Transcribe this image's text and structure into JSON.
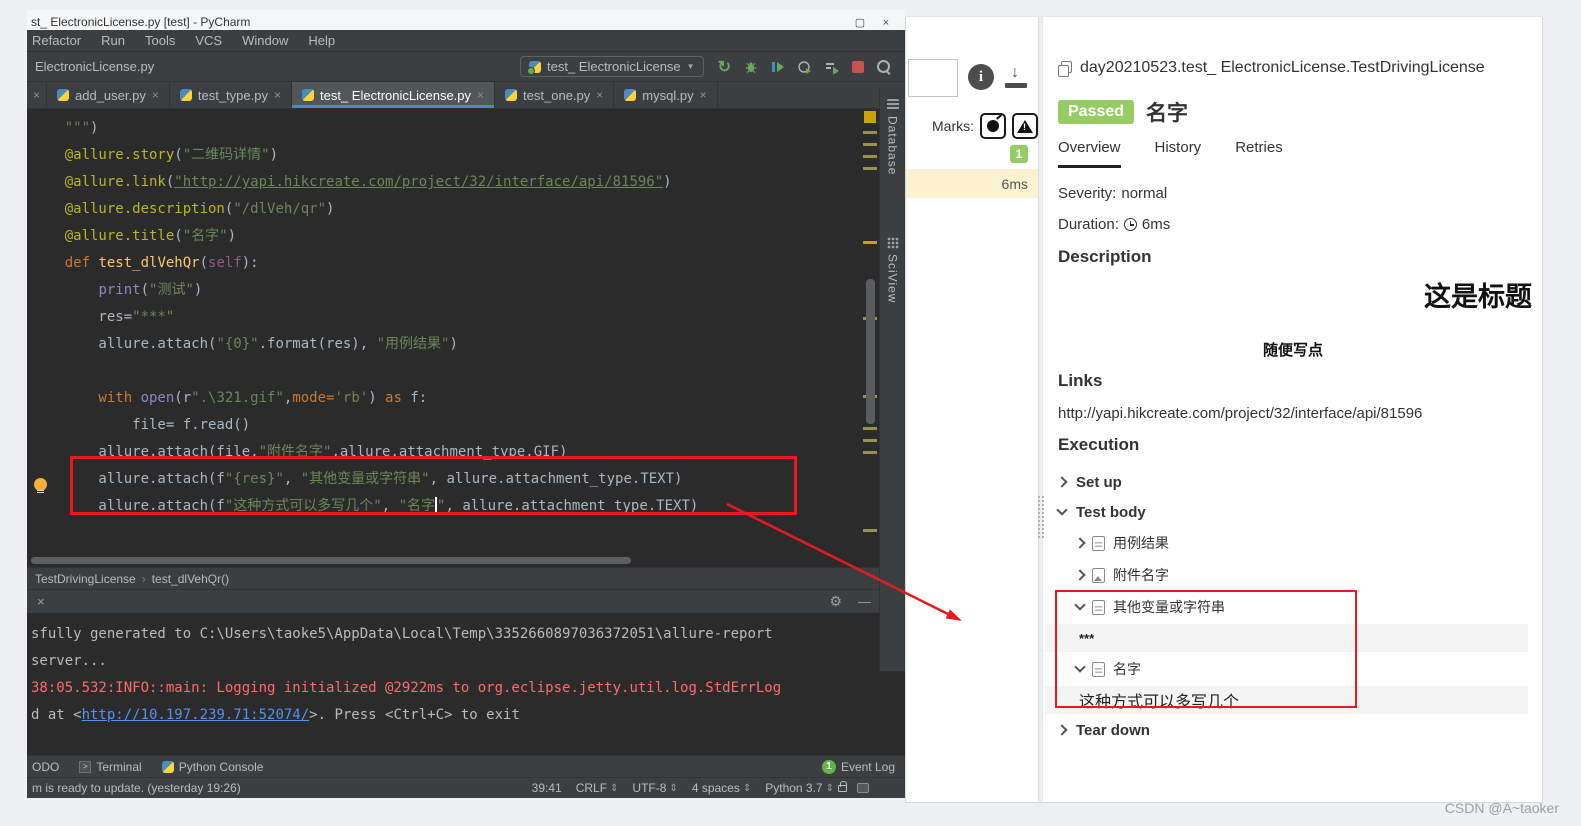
{
  "icons": {
    "close": "×",
    "dropdown": "▼",
    "chevron_sep": "›",
    "rerun": "↻",
    "gear": "⚙",
    "minus": "—",
    "maximize": "▢",
    "updown": "⇕",
    "down_arrow": "↓"
  },
  "pycharm": {
    "window_title": "st_ ElectronicLicense.py [test] - PyCharm",
    "menu": {
      "items": [
        "Refactor",
        "Run",
        "Tools",
        "VCS",
        "Window",
        "Help"
      ]
    },
    "toolbar": {
      "breadcrumb": "ElectronicLicense.py",
      "run_config": "test_ ElectronicLicense"
    },
    "editor_tabs": [
      {
        "stub": true,
        "label": ""
      },
      {
        "label": "add_user.py"
      },
      {
        "label": "test_type.py"
      },
      {
        "label": "test_ ElectronicLicense.py",
        "active": true
      },
      {
        "label": "test_one.py"
      },
      {
        "label": "mysql.py"
      }
    ],
    "code_lines": [
      [
        [
          "s",
          "    \"\"\""
        ],
        [
          "p",
          ")"
        ]
      ],
      [
        [
          "d",
          "    @allure.story"
        ],
        [
          "p",
          "("
        ],
        [
          "s",
          "\"二维码详情\""
        ],
        [
          "p",
          ")"
        ]
      ],
      [
        [
          "d",
          "    @allure.link"
        ],
        [
          "p",
          "("
        ],
        [
          "slink",
          "\"http://yapi.hikcreate.com/project/32/interface/api/81596\""
        ],
        [
          "p",
          ")"
        ]
      ],
      [
        [
          "d",
          "    @allure.description"
        ],
        [
          "p",
          "("
        ],
        [
          "s",
          "\"/dlVeh/qr\""
        ],
        [
          "p",
          ")"
        ]
      ],
      [
        [
          "d",
          "    @allure.title"
        ],
        [
          "p",
          "("
        ],
        [
          "s",
          "\"名字\""
        ],
        [
          "p",
          ")"
        ]
      ],
      [
        [
          "k",
          "    def "
        ],
        [
          "f",
          "test_dlVehQr"
        ],
        [
          "p",
          "("
        ],
        [
          "self",
          "self"
        ],
        [
          "p",
          "):"
        ]
      ],
      [
        [
          "p",
          "        "
        ],
        [
          "b",
          "print"
        ],
        [
          "p",
          "("
        ],
        [
          "s",
          "\"测试\""
        ],
        [
          "p",
          ")"
        ]
      ],
      [
        [
          "p",
          "        res="
        ],
        [
          "s",
          "\"***\""
        ]
      ],
      [
        [
          "p",
          "        allure.attach("
        ],
        [
          "s",
          "\"{0}\""
        ],
        [
          "p",
          ".format(res), "
        ],
        [
          "s",
          "\"用例结果\""
        ],
        [
          "p",
          ")"
        ]
      ],
      [],
      [
        [
          "k",
          "        with "
        ],
        [
          "b",
          "open"
        ],
        [
          "p",
          "(r"
        ],
        [
          "s",
          "\".\\321.gif\""
        ],
        [
          "p",
          ","
        ],
        [
          "k",
          "mode="
        ],
        [
          "s",
          "'rb'"
        ],
        [
          "p",
          ") "
        ],
        [
          "k",
          "as"
        ],
        [
          "p",
          " f:"
        ]
      ],
      [
        [
          "p",
          "            file= f.read()"
        ]
      ],
      [
        [
          "p",
          "        allure.attach(file,"
        ],
        [
          "s",
          "\"附件名字\""
        ],
        [
          "p",
          ",allure.attachment_type.GIF)"
        ]
      ],
      [
        [
          "p",
          "        allure.attach(f"
        ],
        [
          "s",
          "\"{res}\""
        ],
        [
          "p",
          ", "
        ],
        [
          "s",
          "\"其他变量或字符串\""
        ],
        [
          "p",
          ", allure.attachment_type.TEXT)"
        ]
      ],
      [
        [
          "p",
          "        allure.attach(f"
        ],
        [
          "s",
          "\"这种方式可以多写几个\""
        ],
        [
          "p",
          ", "
        ],
        [
          "s",
          "\"名字"
        ],
        [
          "caret",
          ""
        ],
        [
          "s",
          "\""
        ],
        [
          "p",
          ", allure.attachment_type.TEXT)"
        ]
      ]
    ],
    "bottom_breadcrumb": {
      "items": [
        "TestDrivingLicense",
        "test_dlVehQr()"
      ]
    },
    "console_lines": [
      [
        [
          "out",
          "sfully generated to C:\\Users\\taoke5\\AppData\\Local\\Temp\\3352660897036372051\\allure-report"
        ]
      ],
      [
        [
          "out",
          "server..."
        ]
      ],
      [
        [
          "err",
          "38:05.532:INFO::main: Logging initialized @2922ms to org.eclipse.jetty.util.log.StdErrLog"
        ]
      ],
      [
        [
          "out",
          "d at <"
        ],
        [
          "clink",
          "http://10.197.239.71:52074/"
        ],
        [
          "out",
          ">. Press <Ctrl+C> to exit"
        ]
      ]
    ],
    "tool_windows": {
      "right": [
        "Database",
        "SciView"
      ]
    },
    "bottom_bar": {
      "left_items": [
        {
          "label": "ODO",
          "icon": ""
        },
        {
          "label": "Terminal",
          "icon": "terminal"
        },
        {
          "label": "Python Console",
          "icon": "python"
        }
      ],
      "event_log": {
        "badge": "1",
        "label": "Event Log"
      }
    },
    "status_bar": {
      "message": "m is ready to update. (yesterday 19:26)",
      "right_items": [
        {
          "label": "39:41",
          "chevron": false
        },
        {
          "label": "CRLF",
          "chevron": true
        },
        {
          "label": "UTF-8",
          "chevron": true
        },
        {
          "label": "4 spaces",
          "chevron": true
        },
        {
          "label": "Python 3.7",
          "chevron": true
        }
      ]
    }
  },
  "allure": {
    "left_panel": {
      "marks_label": "Marks:",
      "count_badge": "1",
      "selected_duration": "6ms"
    },
    "test_full_name": "day20210523.test_ ElectronicLicense.TestDrivingLicense",
    "status_badge": "Passed",
    "test_title": "名字",
    "tabs": [
      {
        "label": "Overview",
        "active": true
      },
      {
        "label": "History"
      },
      {
        "label": "Retries"
      }
    ],
    "severity_label": "Severity:",
    "severity_value": "normal",
    "duration_label": "Duration:",
    "duration_value": "6ms",
    "description_heading": "Description",
    "description_title": "这是标题",
    "description_sub": "随便写点",
    "links_heading": "Links",
    "link_url": "http://yapi.hikcreate.com/project/32/interface/api/81596",
    "execution_heading": "Execution",
    "execution_tree": [
      {
        "kind": "group",
        "state": "collapsed",
        "label": "Set up"
      },
      {
        "kind": "group",
        "state": "expanded",
        "label": "Test body"
      },
      {
        "kind": "attachment",
        "state": "collapsed",
        "icon": "doc",
        "label": "用例结果"
      },
      {
        "kind": "attachment",
        "state": "collapsed",
        "icon": "img",
        "label": "附件名字"
      },
      {
        "kind": "attachment",
        "state": "expanded",
        "icon": "doc",
        "label": "其他变量或字符串"
      },
      {
        "kind": "content",
        "size": "small",
        "text": "***"
      },
      {
        "kind": "attachment",
        "state": "expanded",
        "icon": "doc",
        "label": "名字"
      },
      {
        "kind": "content",
        "size": "big",
        "text": "这种方式可以多写几个"
      },
      {
        "kind": "group",
        "state": "collapsed",
        "label": "Tear down"
      }
    ]
  },
  "watermark": "CSDN @A~taoker"
}
